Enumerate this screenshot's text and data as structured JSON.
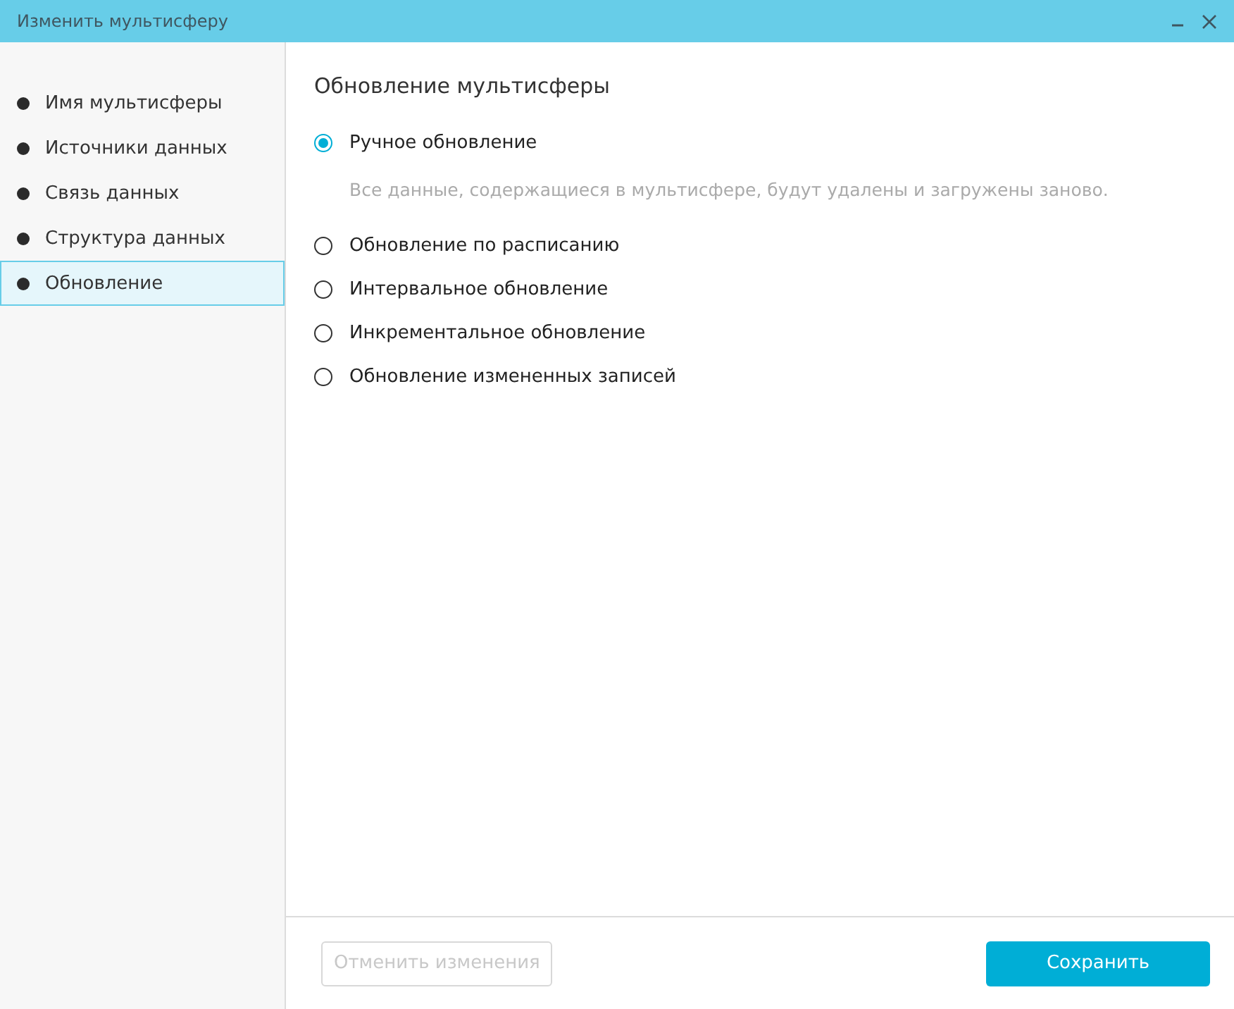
{
  "window": {
    "title": "Изменить мультисферу"
  },
  "sidebar": {
    "items": [
      {
        "label": "Имя мультисферы",
        "selected": false
      },
      {
        "label": "Источники данных",
        "selected": false
      },
      {
        "label": "Связь данных",
        "selected": false
      },
      {
        "label": "Структура данных",
        "selected": false
      },
      {
        "label": "Обновление",
        "selected": true
      }
    ]
  },
  "section_title": "Обновление мультисферы",
  "options": [
    {
      "label": "Ручное обновление",
      "selected": true,
      "description": "Все данные, содержащиеся в мультисфере, будут удалены и загружены заново."
    },
    {
      "label": "Обновление по расписанию",
      "selected": false
    },
    {
      "label": "Интервальное обновление",
      "selected": false
    },
    {
      "label": "Инкрементальное обновление",
      "selected": false
    },
    {
      "label": "Обновление измененных записей",
      "selected": false
    }
  ],
  "buttons": [
    {
      "label": "Отменить изменения",
      "kind": "secondary",
      "disabled": true
    },
    {
      "label": "Сохранить",
      "kind": "primary",
      "disabled": false
    }
  ]
}
